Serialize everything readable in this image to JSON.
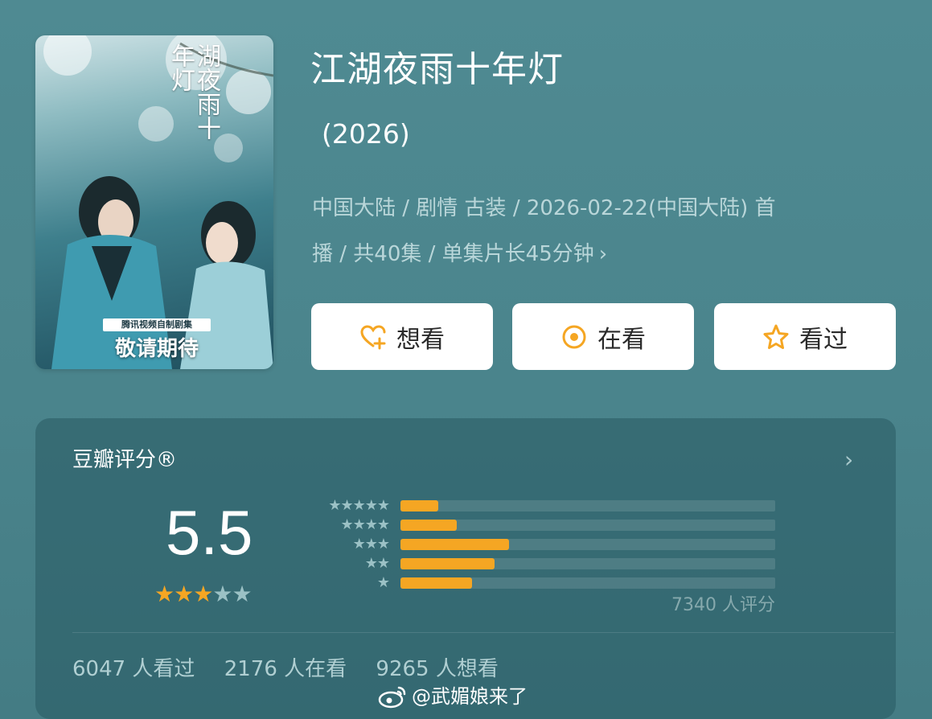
{
  "poster": {
    "title_art": "湖夜雨十年灯",
    "badge": "腾讯视频自制剧集",
    "tagline": "敬请期待"
  },
  "title": "江湖夜雨十年灯",
  "year": "(2026)",
  "meta": {
    "line1": "中国大陆 / 剧情 古装 / 2026-02-22(中国大陆) 首",
    "line2": "播 / 共40集 / 单集片长45分钟",
    "chevron": "›"
  },
  "actions": [
    {
      "label": "想看",
      "icon": "heart-plus-icon"
    },
    {
      "label": "在看",
      "icon": "target-circle-icon"
    },
    {
      "label": "看过",
      "icon": "star-outline-icon"
    }
  ],
  "rating": {
    "label": "豆瓣评分®",
    "score": "5.5",
    "score_stars": "★★★★★",
    "filled_stars": 3,
    "distribution": [
      {
        "stars": "★★★★★",
        "fraction": 0.1
      },
      {
        "stars": "★★★★",
        "fraction": 0.15
      },
      {
        "stars": "★★★",
        "fraction": 0.29
      },
      {
        "stars": "★★",
        "fraction": 0.25
      },
      {
        "stars": "★",
        "fraction": 0.19
      }
    ],
    "count_text": "7340 人评分",
    "chevron": "›"
  },
  "stats": {
    "watched": "6047 人看过",
    "watching": "2176 人在看",
    "want": "9265 人想看"
  },
  "watermark": "@武媚娘来了",
  "colors": {
    "accent": "#f5a623",
    "empty_star": "#9bc1c5"
  }
}
